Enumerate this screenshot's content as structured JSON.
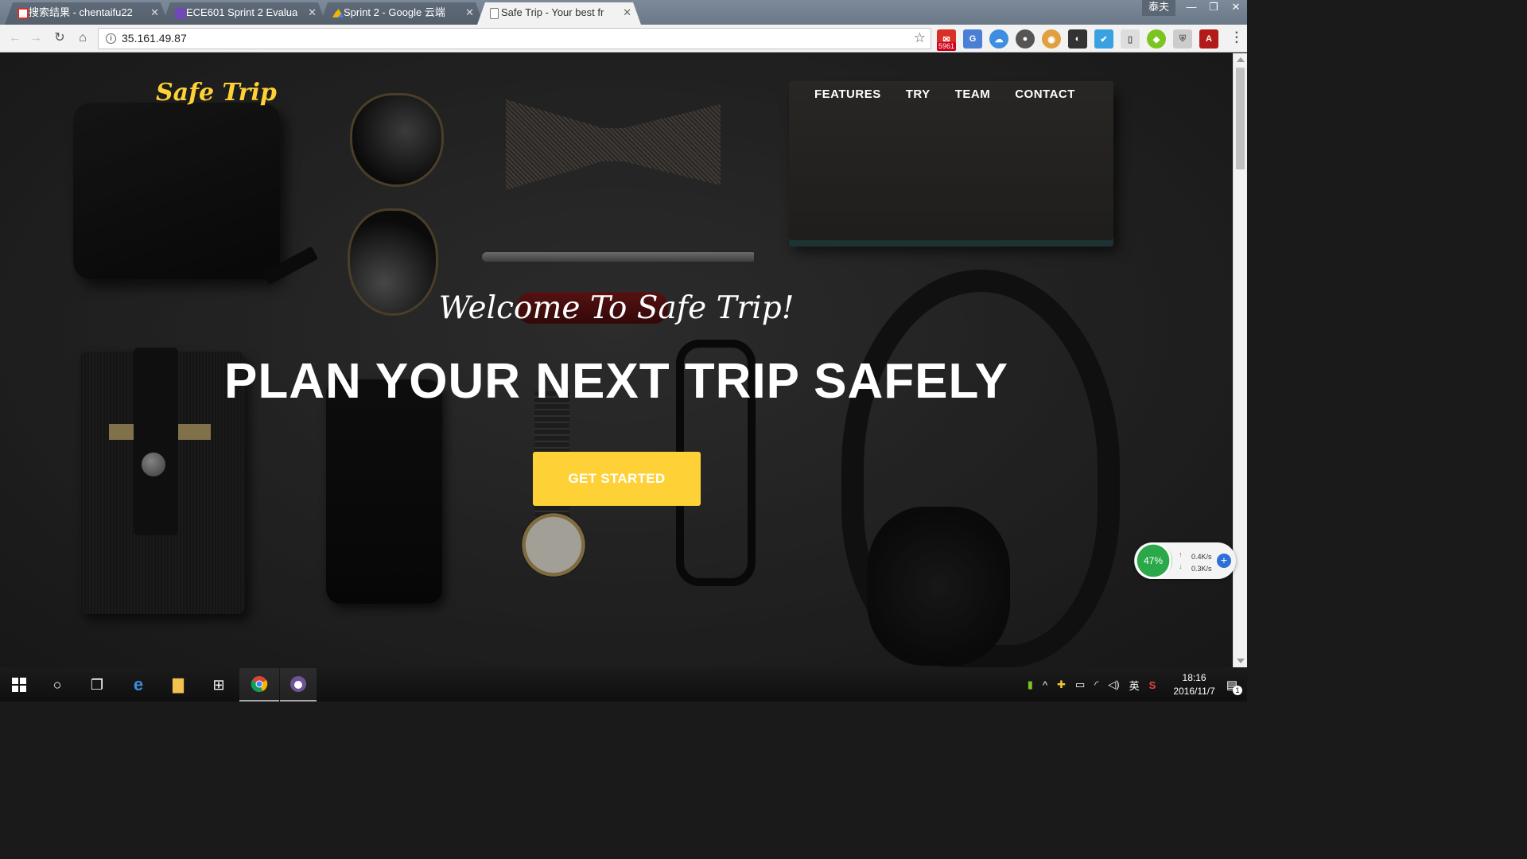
{
  "browser": {
    "tabs": [
      {
        "title": "搜索结果 - chentaifu22",
        "favicon": "gmail-icon",
        "color": "#ffffff"
      },
      {
        "title": "ECE601 Sprint 2 Evalua",
        "favicon": "forms-icon",
        "color": "#7248b9"
      },
      {
        "title": "Sprint 2 - Google 云端",
        "favicon": "drive-icon",
        "color": "#f4b400"
      },
      {
        "title": "Safe Trip - Your best fr",
        "favicon": "page-icon",
        "color": "#ffffff"
      }
    ],
    "profile_name": "泰夫",
    "url": "35.161.49.87",
    "mail_badge": "5961"
  },
  "site": {
    "logo": "Safe Trip",
    "nav": [
      "FEATURES",
      "TRY",
      "TEAM",
      "CONTACT"
    ],
    "welcome": "Welcome To Safe Trip!",
    "hero_title": "PLAN YOUR NEXT TRIP SAFELY",
    "cta_label": "GET STARTED",
    "accent_color": "#fed136"
  },
  "net_widget": {
    "cpu_percent": "47%",
    "upload": "0.4K/s",
    "download": "0.3K/s"
  },
  "taskbar": {
    "ime": "英",
    "time": "18:16",
    "date": "2016/11/7",
    "notifications": "1"
  }
}
